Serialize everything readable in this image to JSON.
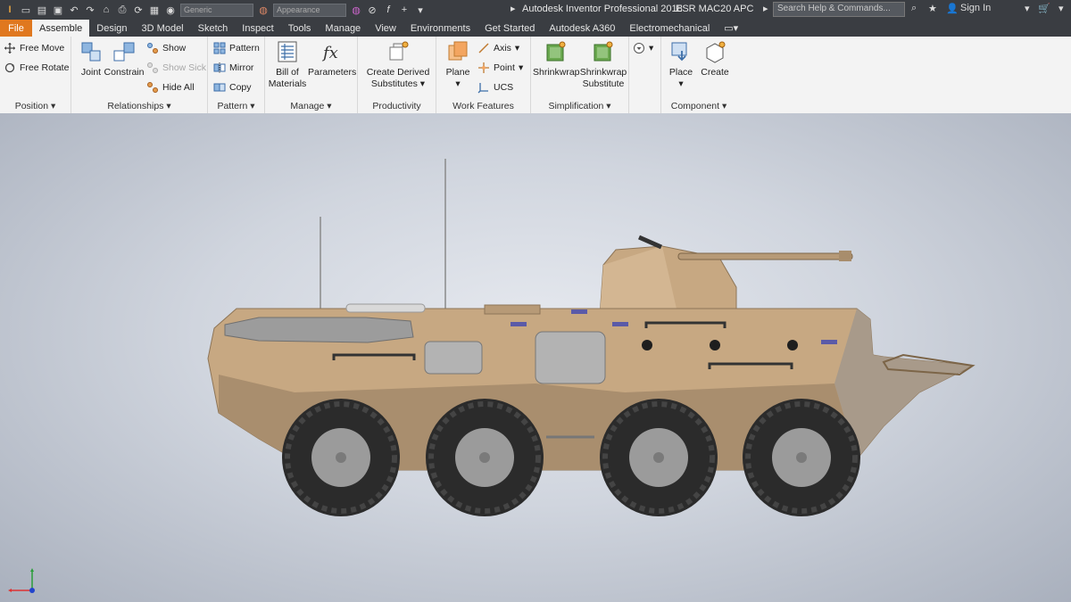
{
  "app": {
    "title": "Autodesk Inventor Professional 2018",
    "document": "ESR MAC20 APC",
    "search_placeholder": "Search Help & Commands...",
    "sign_in": "Sign In",
    "qat_material": "Generic",
    "qat_appearance": "Appearance"
  },
  "tabs": [
    "File",
    "Assemble",
    "Design",
    "3D Model",
    "Sketch",
    "Inspect",
    "Tools",
    "Manage",
    "View",
    "Environments",
    "Get Started",
    "Autodesk A360",
    "Electromechanical"
  ],
  "ribbon": {
    "position": {
      "label": "Position",
      "free_move": "Free Move",
      "free_rotate": "Free Rotate"
    },
    "relationships": {
      "label": "Relationships",
      "joint": "Joint",
      "constrain": "Constrain",
      "show": "Show",
      "show_sick": "Show Sick",
      "hide_all": "Hide All"
    },
    "pattern": {
      "label": "Pattern",
      "pattern": "Pattern",
      "mirror": "Mirror",
      "copy": "Copy"
    },
    "manage": {
      "label": "Manage",
      "bom_line1": "Bill of",
      "bom_line2": "Materials",
      "parameters": "Parameters"
    },
    "productivity": {
      "label": "Productivity",
      "cds_line1": "Create Derived",
      "cds_line2": "Substitutes"
    },
    "work_features": {
      "label": "Work Features",
      "plane": "Plane",
      "axis": "Axis",
      "point": "Point",
      "ucs": "UCS"
    },
    "simplification": {
      "label": "Simplification",
      "shrinkwrap": "Shrinkwrap",
      "sws_line1": "Shrinkwrap",
      "sws_line2": "Substitute"
    },
    "component": {
      "label": "Component",
      "place": "Place",
      "create": "Create"
    }
  },
  "colors": {
    "title_bar": "#3a3d42",
    "file_tab": "#e0781f",
    "ribbon_bg": "#f3f3f3",
    "hull": "#c7a882",
    "tire": "#2b2b2b",
    "wheel_hub": "#9b9b9b"
  }
}
